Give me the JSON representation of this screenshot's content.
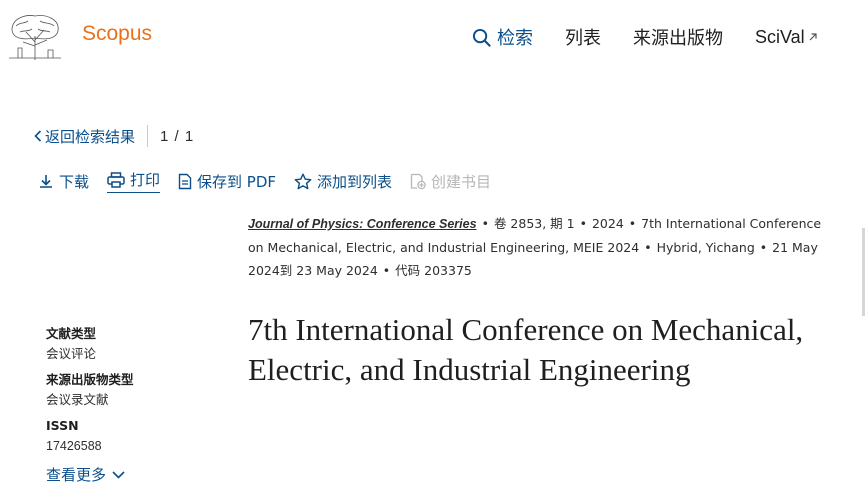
{
  "header": {
    "brand": "Scopus",
    "nav": {
      "search": "检索",
      "lists": "列表",
      "sources": "来源出版物",
      "scival": "SciVal"
    }
  },
  "backbar": {
    "back_label": "返回检索结果",
    "pager": "1 / 1"
  },
  "actions": {
    "download": "下载",
    "print": "打印",
    "save_pdf": "保存到 PDF",
    "add_to_list": "添加到列表",
    "create_bib": "创建书目"
  },
  "source": {
    "journal": "Journal of Physics: Conference Series",
    "volume_issue": "卷 2853, 期 1",
    "year": "2024",
    "conference": "7th International Conference on Mechanical, Electric, and Industrial Engineering, MEIE 2024",
    "location": "Hybrid, Yichang",
    "dates": "21 May 2024到 23 May 2024",
    "code": "代码 203375"
  },
  "sidebar": {
    "doc_type_label": "文献类型",
    "doc_type_value": "会议评论",
    "source_type_label": "来源出版物类型",
    "source_type_value": "会议录文献",
    "issn_label": "ISSN",
    "issn_value": "17426588",
    "more_label": "查看更多"
  },
  "document": {
    "title": "7th International Conference on Mechanical, Electric, and Industrial Engineering"
  },
  "colors": {
    "brand": "#e9711c",
    "link": "#0a4f8a",
    "disabled": "#b7b7b7"
  }
}
